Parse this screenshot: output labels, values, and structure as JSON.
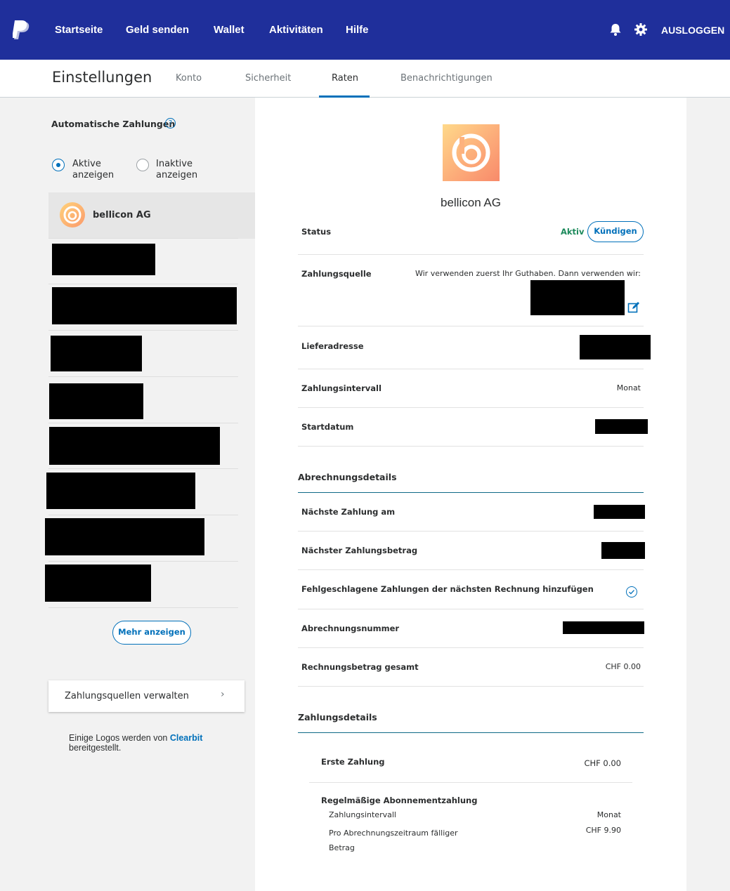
{
  "nav": {
    "items": [
      "Startseite",
      "Geld senden",
      "Wallet",
      "Aktivitäten",
      "Hilfe"
    ],
    "logout": "AUSLOGGEN",
    "icons": [
      "bell-icon",
      "gear-icon"
    ],
    "background": "#1f2f9b"
  },
  "subheader": {
    "title": "Einstellungen",
    "tabs": [
      "Konto",
      "Sicherheit",
      "Raten",
      "Benachrichtigungen"
    ],
    "active_tab": "Raten"
  },
  "left": {
    "section_title": "Automatische Zahlungen",
    "filter": {
      "active_label": "Aktive anzeigen",
      "inactive_label": "Inaktive anzeigen",
      "selected": "Aktive anzeigen"
    },
    "selected_merchant": "bellicon AG",
    "more_button": "Mehr anzeigen",
    "manage_sources": "Zahlungsquellen verwalten",
    "footnote_prefix": "Einige Logos werden von",
    "footnote_link": "Clearbit",
    "footnote_suffix": "bereitgestellt."
  },
  "detail": {
    "merchant_name": "bellicon AG",
    "status_label": "Status",
    "status_value": "Aktiv",
    "cancel_button": "Kündigen",
    "source_label": "Zahlungsquelle",
    "source_text": "Wir verwenden zuerst Ihr Guthaben. Dann verwenden wir:",
    "address_label": "Lieferadresse",
    "interval_label": "Zahlungsintervall",
    "interval_value": "Monat",
    "start_label": "Startdatum",
    "billing_title": "Abrechnungsdetails",
    "next_payment_label": "Nächste Zahlung am",
    "next_amount_label": "Nächster Zahlungsbetrag",
    "failed_label": "Fehlgeschlagene Zahlungen der nächsten Rechnung hinzufügen",
    "billing_number_label": "Abrechnungsnummer",
    "total_label": "Rechnungsbetrag gesamt",
    "total_value": "CHF 0.00",
    "payment_title": "Zahlungsdetails",
    "first_payment_label": "Erste Zahlung",
    "first_payment_value": "CHF 0.00",
    "recurring_label": "Regelmäßige Abonnementzahlung",
    "recurring_interval_label": "Zahlungsintervall",
    "recurring_interval_value": "Monat",
    "per_period_label": "Pro Abrechnungszeitraum fälliger Betrag",
    "per_period_value": "CHF 9.90"
  },
  "colors": {
    "accent": "#0070ba",
    "active_status": "#1d8a5c"
  }
}
